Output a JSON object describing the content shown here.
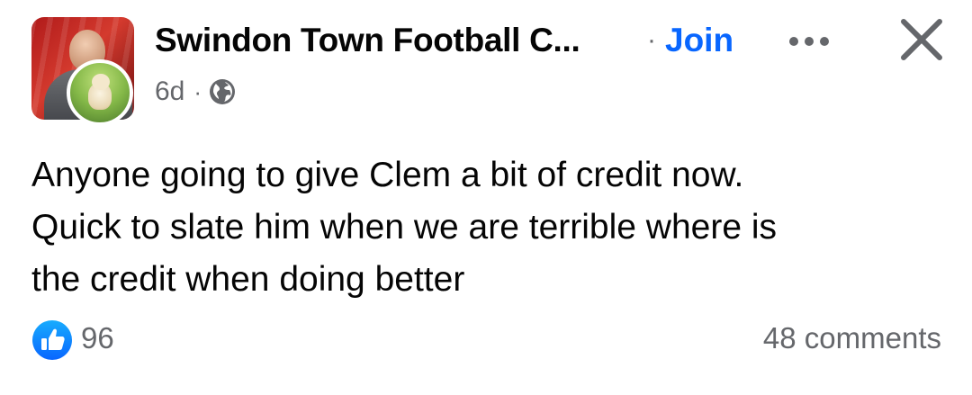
{
  "post": {
    "group_name": "Swindon Town Football C...",
    "separator": "·",
    "join_label": "Join",
    "time_ago": "6d",
    "meta_separator": "·",
    "audience_icon": "globe-icon",
    "text_lines": [
      "Anyone going to give Clem a bit of credit now.",
      "Quick to slate him when we are terrible where is",
      "the credit when doing better"
    ]
  },
  "footer": {
    "reaction_icon": "like-icon",
    "reaction_count": "96",
    "comments": "48 comments"
  },
  "colors": {
    "accent": "#0866ff",
    "secondary_text": "#65676b",
    "primary_text": "#050505"
  }
}
